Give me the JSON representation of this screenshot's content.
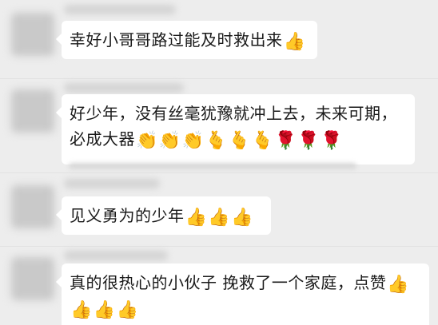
{
  "messages": [
    {
      "text": "幸好小哥哥路过能及时救出来",
      "emojis": [
        "👍"
      ]
    },
    {
      "text_line1": "好少年，没有丝毫犹豫就冲上去，未来可期，",
      "text_line2": "必成大器",
      "emojis": [
        "👏",
        "👏",
        "👏",
        "🫰",
        "🫰",
        "🫰",
        "🌹",
        "🌹",
        "🌹"
      ]
    },
    {
      "text": "见义勇为的少年",
      "emojis": [
        "👍",
        "👍",
        "👍"
      ]
    },
    {
      "text_line1": "真的很热心的小伙子 挽救了一个家庭，点赞",
      "emojis_line1": [
        "👍"
      ],
      "emojis_line2": [
        "👍",
        "👍",
        "👍"
      ]
    }
  ],
  "colors": {
    "background": "#ededed",
    "bubble": "#ffffff",
    "text": "#1a1a1a"
  }
}
